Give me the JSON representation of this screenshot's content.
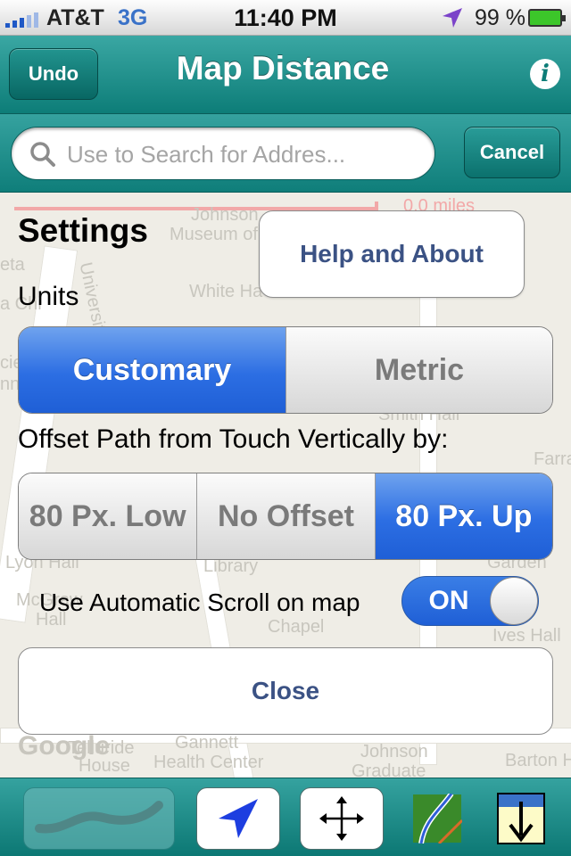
{
  "status": {
    "carrier": "AT&T",
    "network": "3G",
    "time": "11:40 PM",
    "battery": "99 %"
  },
  "navbar": {
    "undo_label": "Undo",
    "title": "Map Distance",
    "info_label": "i"
  },
  "search": {
    "placeholder": "Use to Search for Addres...",
    "cancel_label": "Cancel"
  },
  "map": {
    "labels": [
      "Johnson",
      "Museum of",
      "White Ha",
      "Smith Hall",
      "Lyon Hall",
      "Library",
      "McGraw",
      "Hall",
      "Chapel",
      "Garden",
      "Ives Hall",
      "Farrand",
      "Gannett",
      "Health Center",
      "Johnson",
      "Graduate",
      "Barton H",
      "Telluride",
      "House",
      "University",
      "eta",
      "a Chi",
      "cie",
      "nn",
      "Google",
      "0.0 miles"
    ]
  },
  "settings": {
    "title": "Settings",
    "help_label": "Help and About",
    "units_label": "Units",
    "units_options": [
      "Customary",
      "Metric"
    ],
    "units_selected": "Customary",
    "offset_label": "Offset Path from Touch Vertically by:",
    "offset_options": [
      "80 Px. Low",
      "No Offset",
      "80 Px. Up"
    ],
    "offset_selected": "80 Px. Up",
    "scroll_label": "Use Automatic Scroll on map",
    "scroll_toggle": "ON",
    "close_label": "Close"
  },
  "toolbar": {
    "items": [
      "draw-path-icon",
      "location-arrow-icon",
      "move-arrows-icon",
      "map-layer-icon",
      "download-icon"
    ]
  }
}
